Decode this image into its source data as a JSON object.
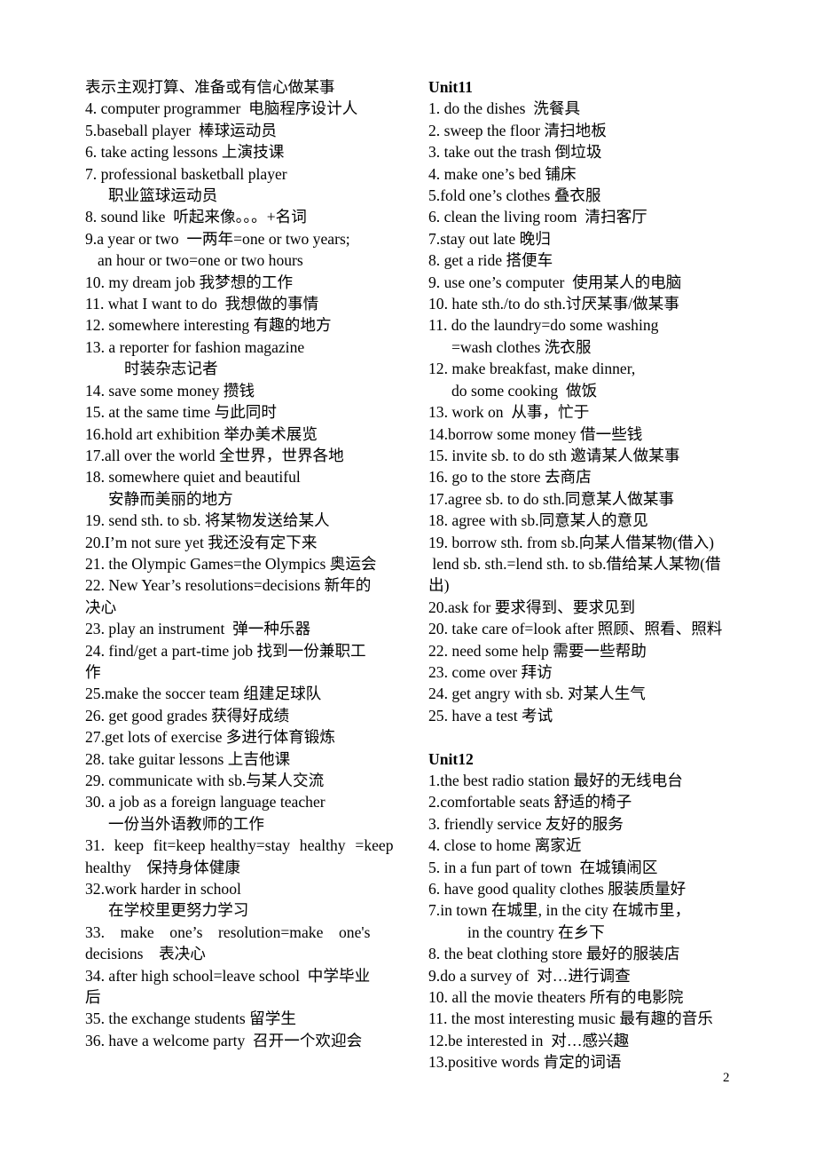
{
  "page": {
    "number": "2"
  },
  "left_column": {
    "lines": [
      {
        "text": "表示主观打算、准备或有信心做某事"
      },
      {
        "text": "4. computer programmer  电脑程序设计人"
      },
      {
        "text": "5.baseball player  棒球运动员"
      },
      {
        "text": "6. take acting lessons 上演技课"
      },
      {
        "text": "7. professional basketball player"
      },
      {
        "text": "职业篮球运动员",
        "indent": 1
      },
      {
        "text": "8. sound like  听起来像。。。+名词"
      },
      {
        "text": "9.a year or two  一两年=one or two years;"
      },
      {
        "text": "an hour or two=one or two hours",
        "indent": 3
      },
      {
        "text": "10. my dream job 我梦想的工作"
      },
      {
        "text": "11. what I want to do  我想做的事情"
      },
      {
        "text": "12. somewhere interesting 有趣的地方"
      },
      {
        "text": "13. a reporter for fashion magazine"
      },
      {
        "text": "时装杂志记者",
        "indent": 2
      },
      {
        "text": "14. save some money 攒钱"
      },
      {
        "text": "15. at the same time 与此同时"
      },
      {
        "text": "16.hold art exhibition 举办美术展览"
      },
      {
        "text": "17.all over the world 全世界，世界各地"
      },
      {
        "text": "18. somewhere quiet and beautiful"
      },
      {
        "text": "安静而美丽的地方",
        "indent": 1
      },
      {
        "text": "19. send sth. to sb. 将某物发送给某人"
      },
      {
        "text": "20.I’m not sure yet 我还没有定下来"
      },
      {
        "text": "21. the Olympic Games=the Olympics 奥运会"
      },
      {
        "text": "22. New Year’s resolutions=decisions 新年的"
      },
      {
        "text": "决心"
      },
      {
        "text": "23. play an instrument  弹一种乐器"
      },
      {
        "text": "24. find/get a part-time job 找到一份兼职工"
      },
      {
        "text": "作"
      },
      {
        "text": "25.make the soccer team 组建足球队"
      },
      {
        "text": "26. get good grades 获得好成绩"
      },
      {
        "text": "27.get lots of exercise 多进行体育锻炼"
      },
      {
        "text": "28. take guitar lessons 上吉他课"
      },
      {
        "text": "29. communicate with sb.与某人交流"
      },
      {
        "text": "30. a job as a foreign language teacher"
      },
      {
        "text": "一份当外语教师的工作",
        "indent": 1
      },
      {
        "text": "31.  keep  fit=keep healthy=stay  healthy  =keep"
      },
      {
        "text": "healthy    保持身体健康"
      },
      {
        "text": "32.work harder in school"
      },
      {
        "text": "在学校里更努力学习",
        "indent": 1
      },
      {
        "text": "33.    make    one’s    resolution=make    one's"
      },
      {
        "text": "decisions    表决心"
      },
      {
        "text": "34. after high school=leave school  中学毕业"
      },
      {
        "text": "后"
      },
      {
        "text": "35. the exchange students 留学生"
      },
      {
        "text": "36. have a welcome party  召开一个欢迎会"
      }
    ]
  },
  "right_column": {
    "unit11": {
      "heading": "Unit11",
      "lines": [
        {
          "text": "1. do the dishes  洗餐具"
        },
        {
          "text": "2. sweep the floor 清扫地板"
        },
        {
          "text": "3. take out the trash 倒垃圾"
        },
        {
          "text": "4. make one’s bed 铺床"
        },
        {
          "text": "5.fold one’s clothes 叠衣服"
        },
        {
          "text": "6. clean the living room  清扫客厅"
        },
        {
          "text": "7.stay out late 晚归"
        },
        {
          "text": "8. get a ride 搭便车"
        },
        {
          "text": "9. use one’s computer  使用某人的电脑"
        },
        {
          "text": "10. hate sth./to do sth.讨厌某事/做某事"
        },
        {
          "text": "11. do the laundry=do some washing"
        },
        {
          "text": "=wash clothes 洗衣服",
          "indent": 1
        },
        {
          "text": "12. make breakfast, make dinner,"
        },
        {
          "text": "do some cooking  做饭",
          "indent": 1
        },
        {
          "text": "13. work on  从事，忙于"
        },
        {
          "text": "14.borrow some money 借一些钱"
        },
        {
          "text": "15. invite sb. to do sth 邀请某人做某事"
        },
        {
          "text": "16. go to the store 去商店"
        },
        {
          "text": "17.agree sb. to do sth.同意某人做某事"
        },
        {
          "text": "18. agree with sb.同意某人的意见"
        },
        {
          "text": "19. borrow sth. from sb.向某人借某物(借入)"
        },
        {
          "text": " lend sb. sth.=lend sth. to sb.借给某人某物(借"
        },
        {
          "text": "出)"
        },
        {
          "text": "20.ask for 要求得到、要求见到"
        },
        {
          "text": "20. take care of=look after 照顾、照看、照料"
        },
        {
          "text": "22. need some help 需要一些帮助"
        },
        {
          "text": "23. come over 拜访"
        },
        {
          "text": "24. get angry with sb. 对某人生气"
        },
        {
          "text": "25. have a test 考试"
        }
      ]
    },
    "unit12": {
      "heading": "Unit12",
      "lines": [
        {
          "text": "1.the best radio station 最好的无线电台"
        },
        {
          "text": "2.comfortable seats 舒适的椅子"
        },
        {
          "text": "3. friendly service 友好的服务"
        },
        {
          "text": "4. close to home 离家近"
        },
        {
          "text": "5. in a fun part of town  在城镇闹区"
        },
        {
          "text": "6. have good quality clothes 服装质量好"
        },
        {
          "text": "7.in town 在城里, in the city 在城市里，"
        },
        {
          "text": "in the country 在乡下",
          "indent": 2
        },
        {
          "text": "8. the beat clothing store 最好的服装店"
        },
        {
          "text": "9.do a survey of  对…进行调查"
        },
        {
          "text": "10. all the movie theaters 所有的电影院"
        },
        {
          "text": "11. the most interesting music 最有趣的音乐"
        },
        {
          "text": "12.be interested in  对…感兴趣"
        },
        {
          "text": "13.positive words 肯定的词语"
        }
      ]
    }
  }
}
